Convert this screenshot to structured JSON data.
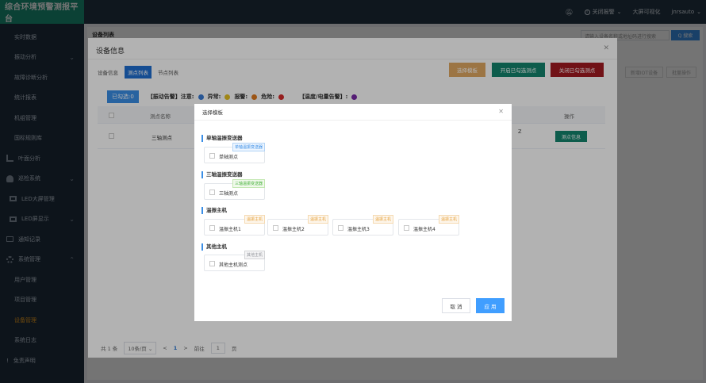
{
  "app": {
    "brand": "综合环境预警测报平台"
  },
  "header": {
    "alarm_label": "关闭报警",
    "big_screen_label": "大屏可视化",
    "user_label": "jnrsauto"
  },
  "sidebar": {
    "items": [
      {
        "label": "实时数据"
      },
      {
        "label": "振动分析"
      },
      {
        "label": "故障诊断分析"
      },
      {
        "label": "统计报表"
      },
      {
        "label": "机组管理"
      },
      {
        "label": "国标规则库"
      },
      {
        "label": "叶面分析"
      },
      {
        "label": "巡检系统"
      },
      {
        "label": "LED大屏管理"
      },
      {
        "label": "LED屏显示"
      },
      {
        "label": "通知记录"
      },
      {
        "label": "系统管理"
      },
      {
        "label": "用户管理"
      },
      {
        "label": "项目管理"
      },
      {
        "label": "设备管理"
      },
      {
        "label": "系统日志"
      },
      {
        "label": "免责声明"
      }
    ]
  },
  "page": {
    "title": "设备列表",
    "search_placeholder": "请输入设备名称或地址码进行搜索",
    "search_button": "Q 搜索",
    "btn_a": "新增IOT设备",
    "btn_b": "批量操作"
  },
  "device_dialog": {
    "title": "设备信息",
    "tabs": [
      "设备信息",
      "测点列表",
      "节点列表"
    ],
    "btn_select_template": "选择模板",
    "btn_enable": "开启已勾选测点",
    "btn_disable": "关闭已勾选测点",
    "selected_count": "已勾选:0",
    "legend_vib": "【振动告警】注意:",
    "legend_abnormal": "异常:",
    "legend_alarm": "报警:",
    "legend_danger": "危险:",
    "legend_temp": "【温度/电量告警】:",
    "col_name": "测点名称",
    "col_op": "操作",
    "row_name": "三轴测点",
    "row_extra": "Z",
    "row_btn": "测点信息",
    "pager_total": "共 1 条",
    "pager_size": "10条/页",
    "pager_prev": "<",
    "pager_page": "1",
    "pager_next": ">",
    "pager_goto": "前往",
    "pager_goto_val": "1",
    "pager_unit": "页"
  },
  "template_dialog": {
    "title": "选择模板",
    "groups": [
      {
        "title": "单轴温振变送器",
        "cards": [
          {
            "label": "单轴测点",
            "tag": "单轴温振变送器"
          }
        ]
      },
      {
        "title": "三轴温振变送器",
        "cards": [
          {
            "label": "三轴测点",
            "tag": "三轴温振变送器"
          }
        ]
      },
      {
        "title": "温振主机",
        "cards": [
          {
            "label": "温振主机1",
            "tag": "温振主机"
          },
          {
            "label": "温振主机2",
            "tag": "温振主机"
          },
          {
            "label": "温振主机3",
            "tag": "温振主机"
          },
          {
            "label": "温振主机4",
            "tag": "温振主机"
          }
        ]
      },
      {
        "title": "其他主机",
        "cards": [
          {
            "label": "其他主机测点",
            "tag": "其他主机"
          }
        ]
      }
    ],
    "cancel": "取 消",
    "apply": "应 用"
  },
  "colors": {
    "brand": "#1a8f76",
    "sidebar": "#1f2d3d",
    "primary": "#409eff",
    "enable": "#14856d",
    "disable": "#a31a22",
    "template_btn": "#e0a862",
    "dot_attention": "#3a7bd5",
    "dot_abnormal": "#e6c020",
    "dot_alarm": "#e07a1f",
    "dot_danger": "#d62b2b",
    "dot_temp": "#7a2aa8"
  }
}
